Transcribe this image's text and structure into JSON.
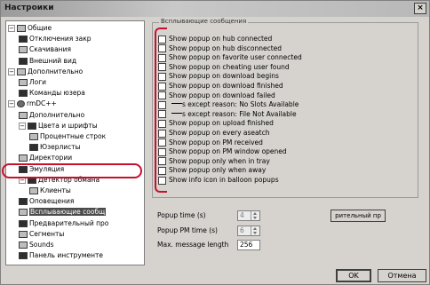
{
  "window": {
    "title": "Настроики",
    "close_glyph": "×"
  },
  "tree": {
    "items": [
      {
        "label": "Общие",
        "expander": "−",
        "icon": "settings-icon"
      },
      {
        "label": "Отключения закр",
        "icon": "window-icon"
      },
      {
        "label": "Скачивания",
        "icon": "download-icon"
      },
      {
        "label": "Внешний вид",
        "icon": "appearance-icon"
      },
      {
        "label": "Дополнительно",
        "expander": "−",
        "icon": "folder-icon"
      },
      {
        "label": "Логи",
        "icon": "log-icon"
      },
      {
        "label": "Команды юзера",
        "icon": "user-commands-icon"
      },
      {
        "label": "rmDC++",
        "expander": "−",
        "icon": "app-icon"
      },
      {
        "label": "Дополнительно",
        "icon": "options-icon"
      },
      {
        "label": "Цвета и шрифты",
        "expander": "−",
        "icon": "colors-icon"
      },
      {
        "label": "Процентные строк",
        "icon": "progress-icon"
      },
      {
        "label": "Юзерлисты",
        "icon": "userlist-icon"
      },
      {
        "label": "Директории",
        "icon": "directory-icon"
      },
      {
        "label": "Эмуляция",
        "icon": "emulation-icon"
      },
      {
        "label": "Детектор обмана",
        "expander": "−",
        "icon": "detector-icon"
      },
      {
        "label": "Клиенты",
        "icon": "clients-icon"
      },
      {
        "label": "Оповещения",
        "icon": "alert-icon"
      },
      {
        "label": "Всплывающие сообщ",
        "icon": "popup-icon",
        "selected": true
      },
      {
        "label": "Предварительный про",
        "icon": "preview-icon"
      },
      {
        "label": "Сегменты",
        "icon": "segments-icon"
      },
      {
        "label": "Sounds",
        "icon": "sound-icon"
      },
      {
        "label": "Панель инструменте",
        "icon": "toolbar-icon"
      }
    ]
  },
  "popups": {
    "group_title": "Всплывающие сообщения",
    "options": [
      "Show popup on hub connected",
      "Show popup on hub disconnected",
      "Show popup on favorite user connected",
      "Show popup on cheating user found",
      "Show popup on download begins",
      "Show popup on download finished",
      "Show popup on download failed",
      "s except reason: No Slots Available",
      "s except reason: File Not Available",
      "Show popup on upload finished",
      "Show popup on every aseatch",
      "Show popup on PM received",
      "Show popup on PM window opened",
      "Show popup only when in tray",
      "Show popup only when away",
      "Show info icon in balloon popups"
    ],
    "fields": [
      {
        "label": "Popup time (s)",
        "value": "4"
      },
      {
        "label": "Popup PM time (s)",
        "value": "6"
      },
      {
        "label": "Max. message length",
        "value": "256"
      }
    ],
    "side_button_label": "рительный пр"
  },
  "footer": {
    "ok_label": "OK",
    "cancel_label": "Отмена"
  },
  "colors": {
    "highlight": "#c8102e"
  }
}
